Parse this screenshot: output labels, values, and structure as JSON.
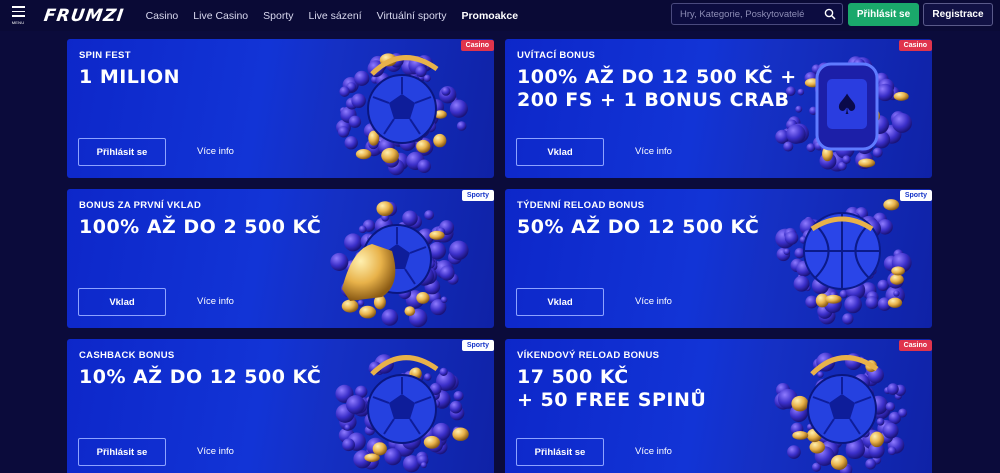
{
  "header": {
    "menu_label": "MENU",
    "logo": "FRUMZI",
    "nav": [
      "Casino",
      "Live Casino",
      "Sporty",
      "Live sázení",
      "Virtuální sporty",
      "Promoakce"
    ],
    "active_nav": "Promoakce",
    "search_placeholder": "Hry, Kategorie, Poskytovatelé",
    "login_label": "Přihlásit se",
    "register_label": "Registrace"
  },
  "promos": [
    {
      "kicker": "SPIN FEST",
      "headline": [
        "1 MILION"
      ],
      "cta": "Přihlásit se",
      "more": "Více info",
      "tag": "Casino",
      "art": "football"
    },
    {
      "kicker": "UVÍTACÍ BONUS",
      "headline": [
        "100% AŽ DO 12 500 KČ +",
        "200 FS + 1 BONUS CRAB"
      ],
      "cta": "Vklad",
      "more": "Více info",
      "tag": "Casino",
      "art": "slot"
    },
    {
      "kicker": "BONUS ZA PRVNÍ VKLAD",
      "headline": [
        "100% AŽ DO 2 500 KČ"
      ],
      "cta": "Vklad",
      "more": "Více info",
      "tag": "Sporty",
      "art": "boot"
    },
    {
      "kicker": "TÝDENNÍ RELOAD BONUS",
      "headline": [
        "50% AŽ DO 12 500 KČ"
      ],
      "cta": "Vklad",
      "more": "Více info",
      "tag": "Sporty",
      "art": "basketball"
    },
    {
      "kicker": "CASHBACK BONUS",
      "headline": [
        "10% AŽ DO 12 500 KČ"
      ],
      "cta": "Přihlásit se",
      "more": "Více info",
      "tag": "Sporty",
      "art": "football"
    },
    {
      "kicker": "VÍKENDOVÝ RELOAD BONUS",
      "headline": [
        "17 500 KČ",
        "+ 50 FREE SPINŮ"
      ],
      "cta": "Přihlásit se",
      "more": "Více info",
      "tag": "Casino",
      "art": "football"
    }
  ],
  "colors": {
    "page_bg": "#0b0b3b",
    "card_blue": "#1234d6",
    "login_green": "#1aa86b",
    "casino_tag": "#e0344c",
    "sporty_tag_text": "#1534c8",
    "gold": "#e8b24a"
  }
}
